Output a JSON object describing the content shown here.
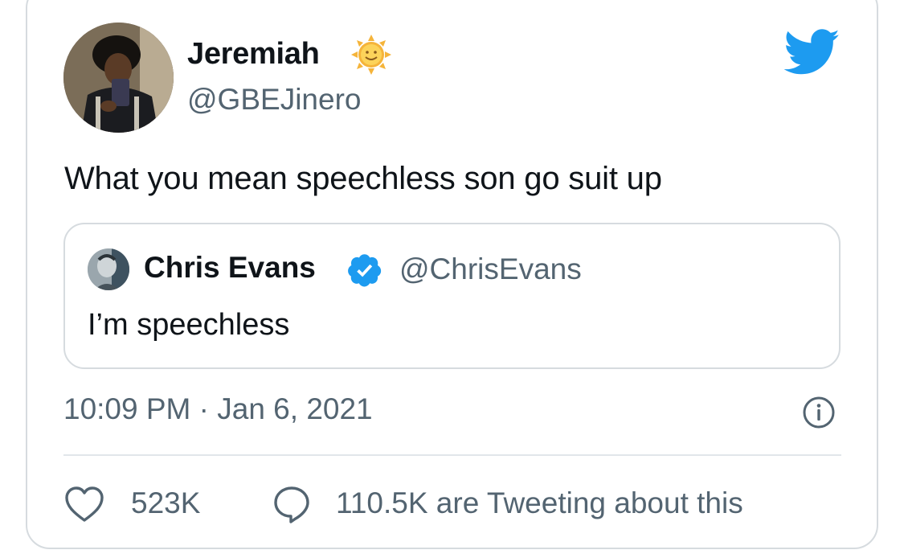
{
  "tweet": {
    "author": {
      "display_name": "Jeremiah",
      "handle": "@GBEJinero",
      "name_emoji": "sun-with-face-icon"
    },
    "text": "What you mean speechless son go suit up",
    "timestamp": "10:09 PM · Jan 6, 2021",
    "likes": "523K",
    "tweeting": "110.5K are Tweeting about this"
  },
  "quoted_tweet": {
    "author": {
      "display_name": "Chris Evans",
      "handle": "@ChrisEvans",
      "verified": true
    },
    "text": "I’m speechless"
  },
  "icons": {
    "brand": "twitter-bird-icon",
    "verified": "verified-badge-icon",
    "info": "info-icon",
    "like": "heart-icon",
    "reply": "speech-bubble-icon"
  },
  "colors": {
    "twitter_blue": "#1d9bf0",
    "secondary_text": "#536471",
    "border": "#d6dbdf"
  }
}
